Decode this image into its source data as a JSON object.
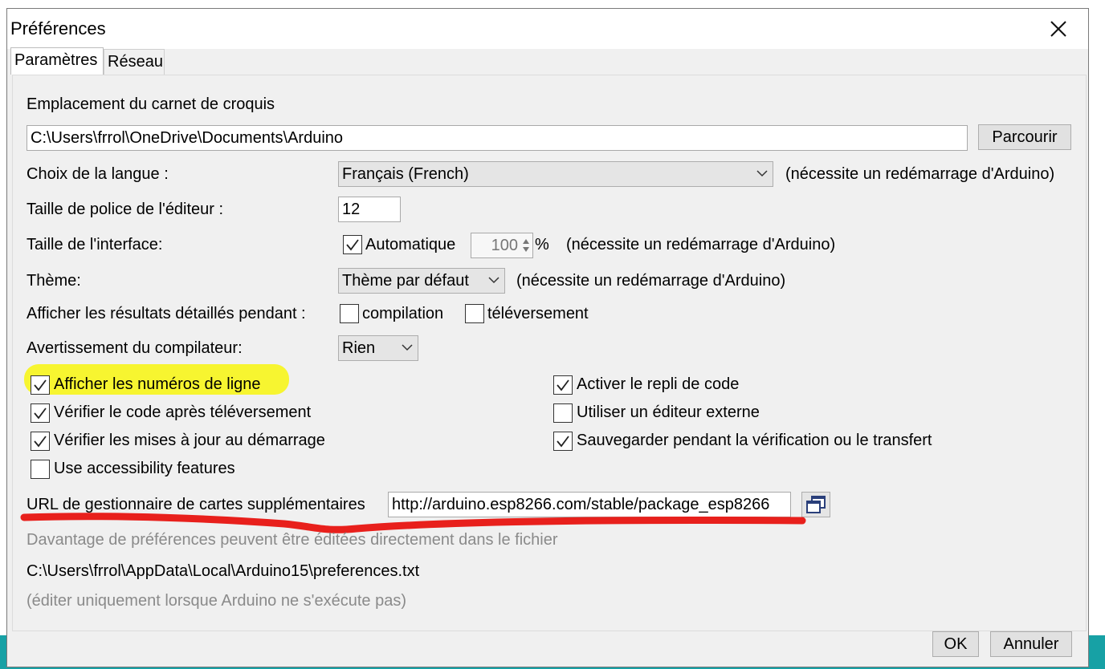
{
  "dialog": {
    "title": "Préférences",
    "tabs": [
      "Paramètres",
      "Réseau"
    ]
  },
  "sketchbook": {
    "label": "Emplacement du carnet de croquis",
    "path": "C:\\Users\\frrol\\OneDrive\\Documents\\Arduino",
    "browse_label": "Parcourir"
  },
  "language": {
    "label": "Choix de la langue :",
    "value": "Français (French)",
    "note": "(nécessite un redémarrage d'Arduino)"
  },
  "font_size": {
    "label": "Taille de police de l'éditeur :",
    "value": "12"
  },
  "interface_size": {
    "label": "Taille de l'interface:",
    "auto_label": "Automatique",
    "auto_checked": true,
    "value": "100",
    "unit": "%",
    "note": "(nécessite un redémarrage d'Arduino)"
  },
  "theme": {
    "label": "Thème:",
    "value": "Thème par défaut",
    "note": "(nécessite un redémarrage d'Arduino)"
  },
  "verbose": {
    "label": "Afficher les résultats détaillés pendant :",
    "compile_label": "compilation",
    "compile_checked": false,
    "upload_label": "téléversement",
    "upload_checked": false
  },
  "warnings": {
    "label": "Avertissement du compilateur:",
    "value": "Rien"
  },
  "options_left": [
    {
      "label": "Afficher les numéros de ligne",
      "checked": true
    },
    {
      "label": "Vérifier le code après téléversement",
      "checked": true
    },
    {
      "label": "Vérifier les mises à jour au démarrage",
      "checked": true
    },
    {
      "label": "Use accessibility features",
      "checked": false
    }
  ],
  "options_right": [
    {
      "label": "Activer le repli de code",
      "checked": true
    },
    {
      "label": "Utiliser un éditeur externe",
      "checked": false
    },
    {
      "label": "Sauvegarder pendant la vérification ou le transfert",
      "checked": true
    }
  ],
  "board_urls": {
    "label": "URL de gestionnaire de cartes supplémentaires",
    "value": "http://arduino.esp8266.com/stable/package_esp8266"
  },
  "footer": {
    "more_prefs": "Davantage de préférences peuvent être éditées directement dans le fichier",
    "prefs_path": "C:\\Users\\frrol\\AppData\\Local\\Arduino15\\preferences.txt",
    "edit_note": "(éditer uniquement lorsque Arduino ne s'exécute pas)"
  },
  "buttons": {
    "ok": "OK",
    "cancel": "Annuler"
  },
  "colors": {
    "highlight": "#f7f530",
    "annotation_red": "#e8201c",
    "ide_teal": "#17a1a5"
  }
}
